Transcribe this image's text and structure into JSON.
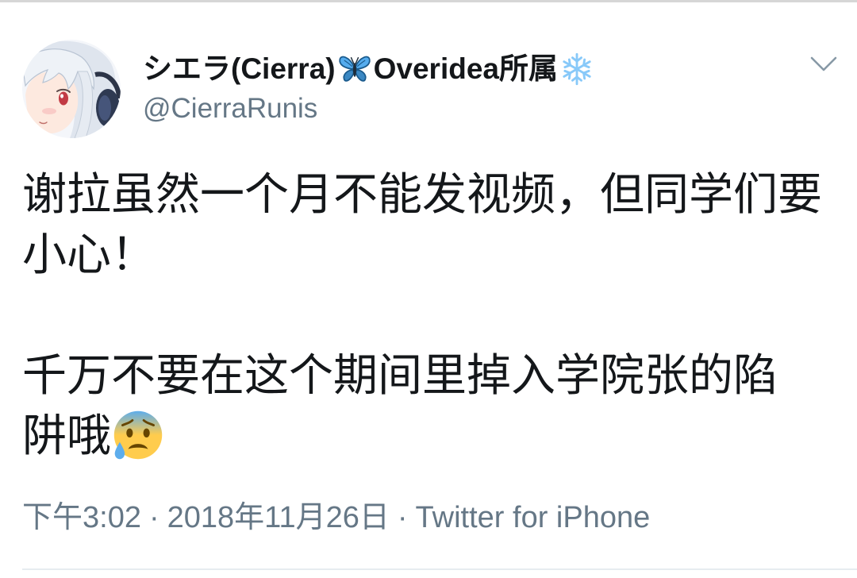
{
  "tweet": {
    "author": {
      "name_part_1": "シエラ(Cierra)",
      "name_emoji_1": "butterfly-icon",
      "name_part_2": "Overidea所属",
      "name_emoji_2": "snowflake-icon",
      "handle": "@CierraRunis",
      "avatar": "avatar-image"
    },
    "menu_icon": "chevron-down-icon",
    "body": {
      "paragraph_1_lines": [
        "谢拉虽然一个月不能发视频，但同学们要",
        "小心！"
      ],
      "paragraph_2_lines": [
        "千万不要在这个期间里掉入学院张的陷",
        "阱哦"
      ],
      "trailing_emoji": "anxious-face-with-sweat-icon"
    },
    "meta": {
      "time": "下午3:02",
      "separator": "·",
      "date": "2018年11月26日",
      "source": "Twitter for iPhone"
    }
  },
  "colors": {
    "text": "#14171a",
    "secondary_text": "#657786",
    "divider": "#e6ecf0",
    "chevron": "#8899a6"
  }
}
